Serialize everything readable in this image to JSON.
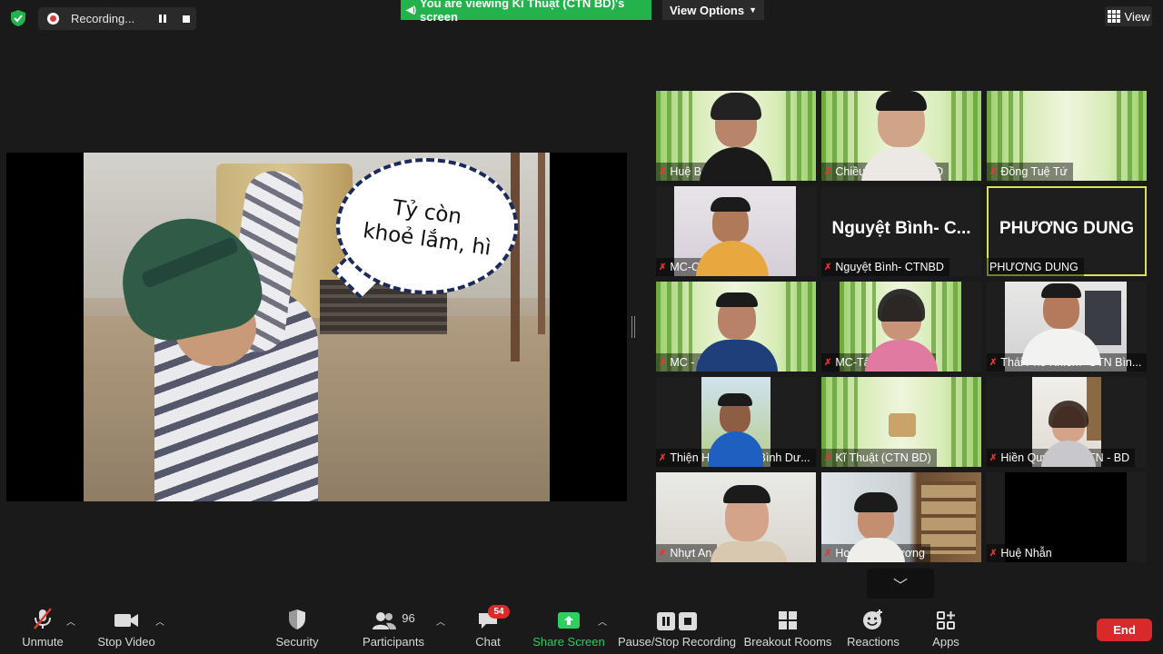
{
  "top": {
    "recording_label": "Recording...",
    "viewing_banner": "You are viewing Kĩ Thuật (CTN BD)'s screen",
    "view_options_label": "View Options",
    "view_label": "View"
  },
  "share": {
    "bubble_line1": "Tỷ còn",
    "bubble_line2": "khoẻ lắm, hì"
  },
  "tiles": [
    {
      "name": "Huệ Bửu Thịnh",
      "muted": true
    },
    {
      "name": "Chiều Khải - CTN BD",
      "muted": true
    },
    {
      "name": "Đồng Tuệ Tứ",
      "muted": true
    },
    {
      "name": "MC-Cần Giải",
      "muted": true
    },
    {
      "name": "Nguyệt Bình- CTNBD",
      "muted": true,
      "big_name": "Nguyệt Bình- C..."
    },
    {
      "name": "PHƯƠNG DUNG",
      "muted": false,
      "big_name": "PHƯƠNG DUNG",
      "active_speaker": true
    },
    {
      "name": "MC - Kiên Vinh",
      "muted": true
    },
    {
      "name": "MC-Tâm Bình Cận",
      "muted": true
    },
    {
      "name": "Thái Phổ Khiêm- CTN Bìn...",
      "muted": true
    },
    {
      "name": "Thiện Huy - CTN Bình Dư...",
      "muted": true
    },
    {
      "name": "Kĩ Thuật (CTN BD)",
      "muted": true
    },
    {
      "name": "Hiền Quý Tuệ - CTN - BD",
      "muted": true
    },
    {
      "name": "Nhựt An",
      "muted": true
    },
    {
      "name": "Hoà Đăng Vương",
      "muted": true
    },
    {
      "name": "Huệ Nhẫn",
      "muted": true
    }
  ],
  "mic_off_glyph": "✗",
  "toolbar": {
    "unmute": "Unmute",
    "stop_video": "Stop Video",
    "security": "Security",
    "participants": "Participants",
    "participants_count": "96",
    "chat": "Chat",
    "chat_badge": "54",
    "share_screen": "Share Screen",
    "pause_stop_recording": "Pause/Stop Recording",
    "breakout_rooms": "Breakout Rooms",
    "reactions": "Reactions",
    "apps": "Apps",
    "end": "End"
  },
  "colors": {
    "background": "#1a1a1a",
    "banner_green": "#23b24b",
    "share_green": "#2fcf5b",
    "end_red": "#d9292a",
    "active_speaker_outline": "#d8e35a",
    "mic_off_red": "#e0392e"
  }
}
